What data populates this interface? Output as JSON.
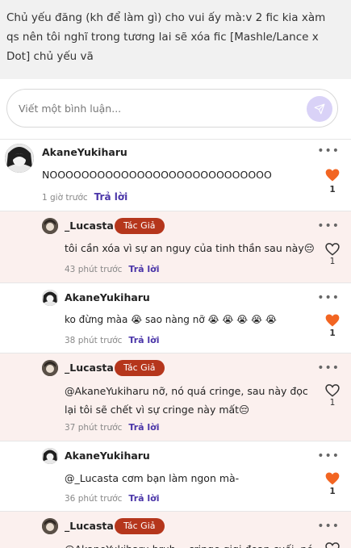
{
  "note": {
    "text": "Chủ yếu đăng (kh để làm gì) cho vui ấy mà:v 2 fic kia xàm qs nên tôi nghĩ trong tương lai sẽ xóa fic [Mashle/Lance x Dot] chủ yếu vã"
  },
  "comment_box": {
    "placeholder": "Viết một bình luận..."
  },
  "reply_label": "Trả lời",
  "author_badge": "Tác Giả",
  "colors": {
    "accent": "#4a35a8",
    "badge": "#b5361c",
    "heart_liked": "#f26522",
    "reply_bg": "#fbf0ee",
    "send_bg": "#d9d2f7"
  },
  "comments": [
    {
      "user": "AkaneYukiharu",
      "text": "NOOOOOOOOOOOOOOOOOOOOOOOOOOOO",
      "time": "1 giờ trước",
      "likes": "1",
      "liked": true
    },
    {
      "user": "_Lucasta",
      "author": true,
      "text": "tôi cần xóa vì sự an nguy của tinh thần sau này😔",
      "time": "43 phút trước",
      "likes": "1",
      "liked": false
    },
    {
      "user": "AkaneYukiharu",
      "text": "ko đừng màa 😭 sao nàng nỡ 😭 😭 😭 😭 😭",
      "time": "38 phút trước",
      "likes": "1",
      "liked": true
    },
    {
      "user": "_Lucasta",
      "author": true,
      "text_line1": "@AkaneYukiharu nỡ, nó quá cringe, sau này đọc",
      "text_line2": "lại tôi sẽ chết vì sự cringe này mất😔",
      "time": "37 phút trước",
      "likes": "1",
      "liked": false
    },
    {
      "user": "AkaneYukiharu",
      "text": "@_Lucasta cơm bạn làm ngon mà-",
      "time": "36 phút trước",
      "likes": "1",
      "liked": true
    },
    {
      "user": "_Lucasta",
      "author": true,
      "text": "@AkaneYukiharu bruh... cringe gigi đoạn cuối, nó",
      "time": "",
      "likes": "",
      "liked": false
    }
  ]
}
